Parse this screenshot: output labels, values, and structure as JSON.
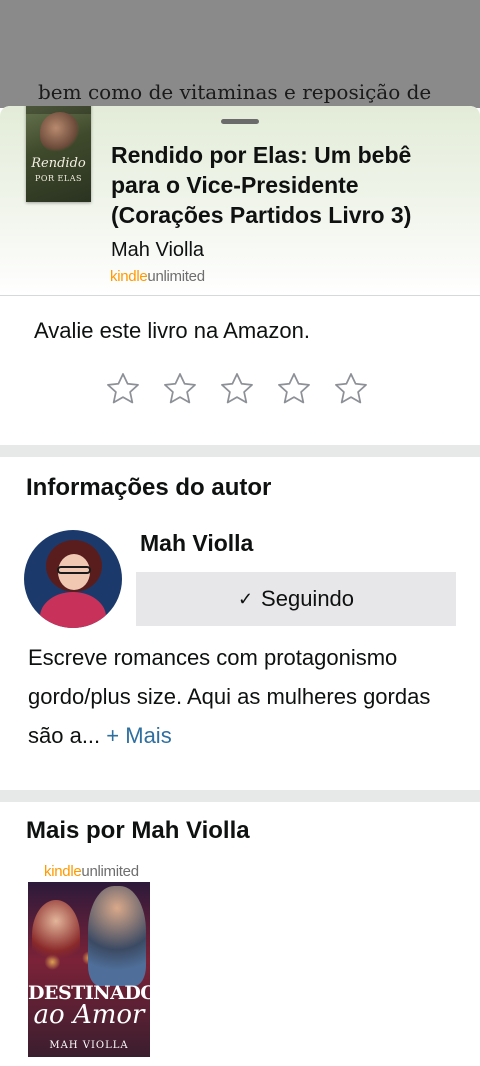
{
  "backdrop": {
    "text": "bem como de vitaminas e reposição de"
  },
  "book": {
    "cover_script": "Rendido",
    "cover_subtitle": "POR ELAS",
    "title": "Rendido por Elas: Um bebê para o Vice-Presidente (Corações Partidos Livro 3)",
    "author": "Mah Violla",
    "badge_kindle": "kindle",
    "badge_unlimited": "unlimited"
  },
  "rating": {
    "prompt": "Avalie este livro na Amazon.",
    "stars_total": 5,
    "stars_selected": 0
  },
  "author_section": {
    "title": "Informações do autor",
    "name": "Mah Violla",
    "follow_icon": "check-icon",
    "follow_check": "✓",
    "follow_label": "Seguindo",
    "bio": "Escreve romances com protagonismo gordo/plus size. Aqui as mulheres gordas são a... ",
    "more_label": "+ Mais"
  },
  "more_by": {
    "title": "Mais por Mah Violla",
    "items": [
      {
        "badge_kindle": "kindle",
        "badge_unlimited": "unlimited",
        "cover_title_line1": "DESTINADOS",
        "cover_title_line2": "ao Amor",
        "cover_author": "MAH VIOLLA"
      }
    ]
  },
  "colors": {
    "kindle_orange": "#ff9900",
    "link_blue": "#2f6f9f",
    "button_gray": "#e7e7e9",
    "divider_gray": "#e7e9e9"
  }
}
